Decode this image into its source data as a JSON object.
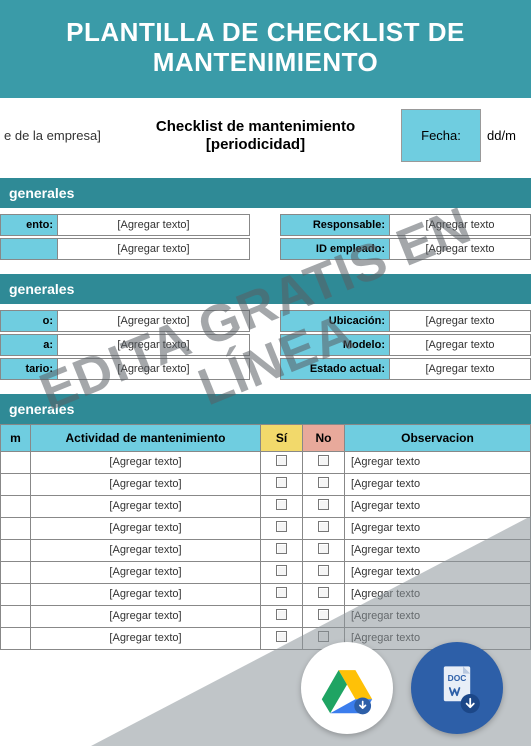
{
  "banner": "PLANTILLA DE CHECKLIST DE MANTENIMIENTO",
  "watermark_line1": "EDITA GRATIS EN",
  "watermark_line2": "LÍNEA",
  "title": {
    "company_placeholder": "e de la empresa]",
    "main_line1": "Checklist de mantenimiento",
    "main_line2": "[periodicidad]",
    "fecha_label": "Fecha:",
    "date_value": "dd/m"
  },
  "section1": {
    "heading": "generales",
    "left": [
      {
        "label": "ento:",
        "value": "[Agregar texto]"
      },
      {
        "label": "",
        "value": "[Agregar texto]"
      }
    ],
    "right": [
      {
        "label": "Responsable:",
        "value": "[Agregar texto"
      },
      {
        "label": "ID empleado:",
        "value": "[Agregar texto"
      }
    ]
  },
  "section2": {
    "heading": "generales",
    "left": [
      {
        "label": "o:",
        "value": "[Agregar texto]"
      },
      {
        "label": "a:",
        "value": "[Agregar texto]"
      },
      {
        "label": "tario:",
        "value": "[Agregar texto]"
      }
    ],
    "right": [
      {
        "label": "Ubicación:",
        "value": "[Agregar texto"
      },
      {
        "label": "Modelo:",
        "value": "[Agregar texto"
      },
      {
        "label": "Estado actual:",
        "value": "[Agregar texto"
      }
    ]
  },
  "section3_heading": "generales",
  "checklist": {
    "headers": {
      "item": "m",
      "activity": "Actividad de mantenimiento",
      "si": "Sí",
      "no": "No",
      "obs": "Observacion"
    },
    "rows": [
      {
        "activity": "[Agregar texto]",
        "obs": "[Agregar texto"
      },
      {
        "activity": "[Agregar texto]",
        "obs": "[Agregar texto"
      },
      {
        "activity": "[Agregar texto]",
        "obs": "[Agregar texto"
      },
      {
        "activity": "[Agregar texto]",
        "obs": "[Agregar texto"
      },
      {
        "activity": "[Agregar texto]",
        "obs": "[Agregar texto"
      },
      {
        "activity": "[Agregar texto]",
        "obs": "[Agregar texto"
      },
      {
        "activity": "[Agregar texto]",
        "obs": "[Agregar texto"
      },
      {
        "activity": "[Agregar texto]",
        "obs": "[Agregar texto"
      },
      {
        "activity": "[Agregar texto]",
        "obs": "[Agregar texto"
      }
    ]
  },
  "icons": {
    "drive": "google-drive-download-icon",
    "word": "word-doc-download-icon"
  }
}
